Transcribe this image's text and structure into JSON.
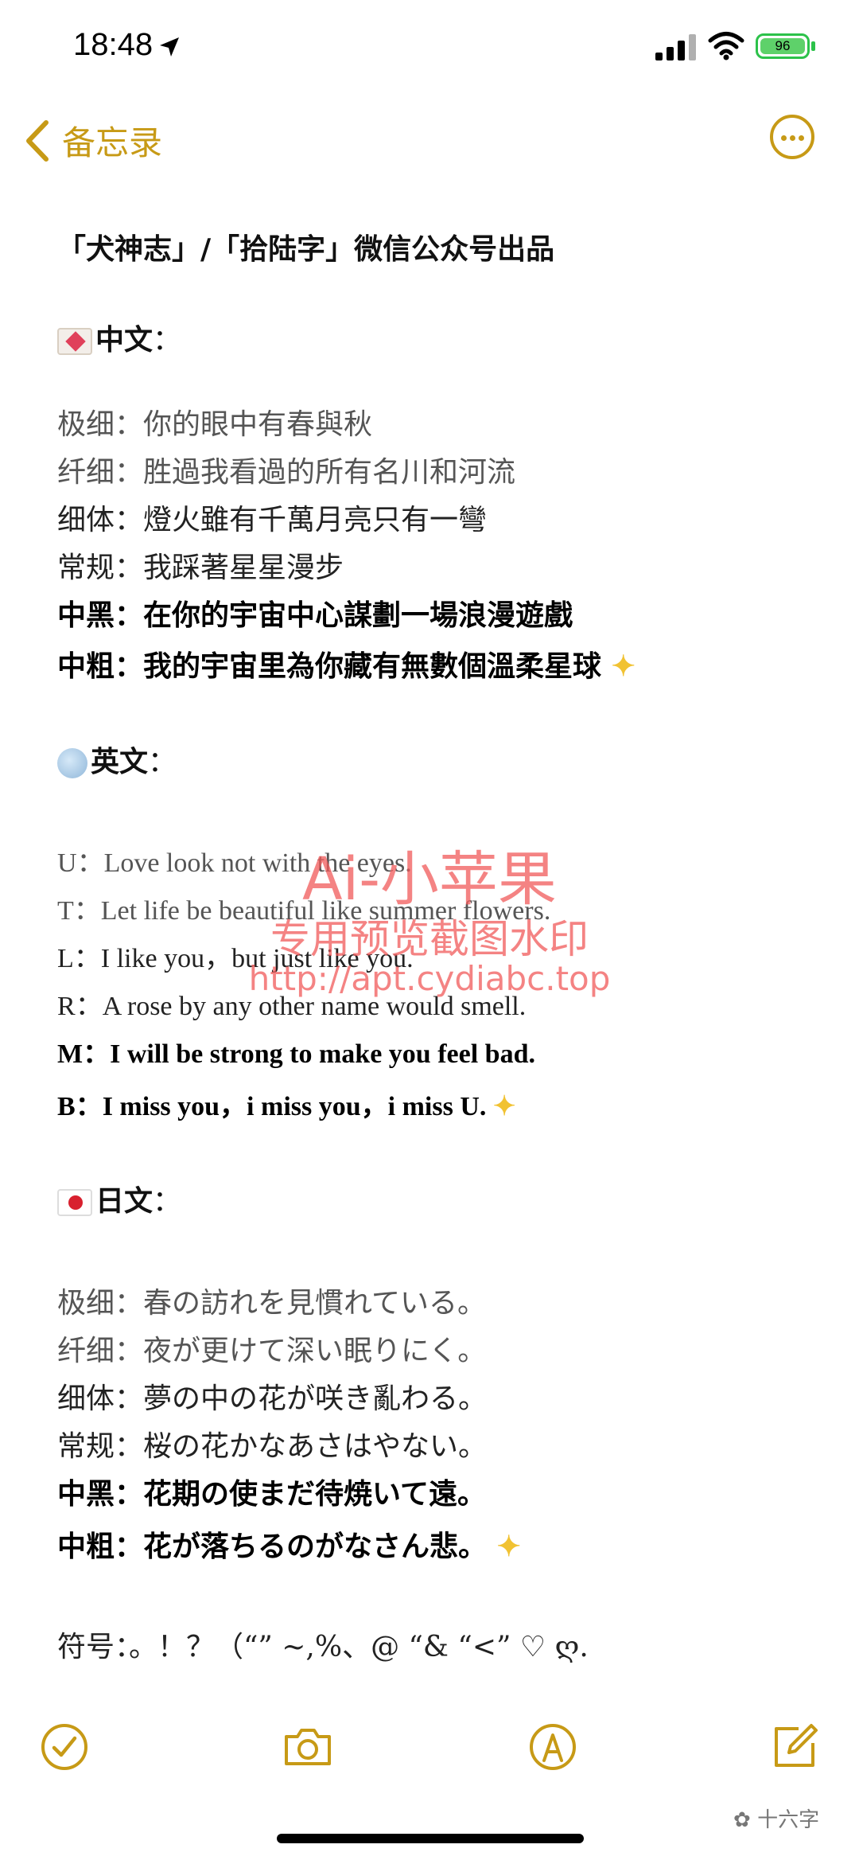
{
  "status": {
    "time": "18:48",
    "battery": "96"
  },
  "nav": {
    "back_label": "备忘录"
  },
  "note": {
    "title": "「犬神志」/「拾陆字」微信公众号出品",
    "chinese_header": "中文",
    "chinese": [
      {
        "weight": "极细",
        "sep": "：",
        "text": "你的眼中有春與秋"
      },
      {
        "weight": "纤细",
        "sep": "：",
        "text": "胜過我看過的所有名川和河流"
      },
      {
        "weight": "细体",
        "sep": "：",
        "text": "燈火雖有千萬月亮只有一彎"
      },
      {
        "weight": "常规",
        "sep": "：",
        "text": "我踩著星星漫步"
      },
      {
        "weight": "中黑",
        "sep": "：",
        "text": "在你的宇宙中心謀劃一場浪漫遊戲"
      },
      {
        "weight": "中粗",
        "sep": "：",
        "text": "我的宇宙里為你藏有無數個溫柔星球"
      }
    ],
    "english_header": "英文",
    "english": [
      {
        "weight": "U",
        "sep": "：",
        "text": "Love look not with the eyes."
      },
      {
        "weight": "T",
        "sep": "：",
        "text": "Let life be beautiful like summer flowers."
      },
      {
        "weight": "L",
        "sep": "：",
        "text": "I like you，but just like you."
      },
      {
        "weight": "R",
        "sep": "：",
        "text": "A rose by any other name would smell."
      },
      {
        "weight": "M",
        "sep": "：",
        "text": "I will be strong to make you feel bad."
      },
      {
        "weight": "B",
        "sep": "：",
        "text": "I miss you，i miss you，i miss U."
      }
    ],
    "japanese_header": "日文",
    "japanese": [
      {
        "weight": "极细",
        "sep": "：",
        "text": "春の訪れを見慣れている。"
      },
      {
        "weight": "纤细",
        "sep": "：",
        "text": "夜が更けて深い眠りにく。"
      },
      {
        "weight": "细体",
        "sep": "：",
        "text": "夢の中の花が咲き亂わる。"
      },
      {
        "weight": "常规",
        "sep": "：",
        "text": "桜の花かなあさはやない。"
      },
      {
        "weight": "中黑",
        "sep": "：",
        "text": "花期の使まだ待焼いて遠。"
      },
      {
        "weight": "中粗",
        "sep": "：",
        "text": "花が落ちるのがなさん悲。"
      }
    ],
    "symbols_label": "符号",
    "symbols": "：。！？（“” ~,%、@ “& “<” ♡ ღ."
  },
  "watermark": {
    "line1": "Ai-小苹果",
    "line2": "专用预览截图水印",
    "line3": "http://apt.cydiabc.top"
  },
  "footer": {
    "wechat_label": "十六字"
  },
  "colors": {
    "accent": "#c79a16"
  }
}
